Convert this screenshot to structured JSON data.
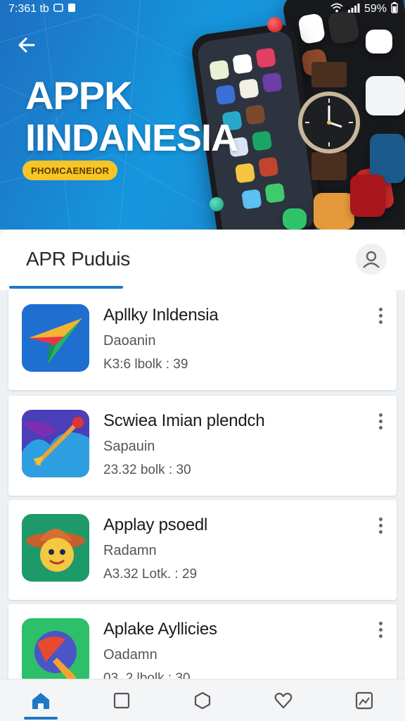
{
  "status_bar": {
    "time": "7:361 tb",
    "battery_text": "59%"
  },
  "hero": {
    "title_line1": "APPK",
    "title_line2": "IINDANESIA",
    "badge": "PHOMCAENEIOR"
  },
  "section": {
    "title": "APR Puduis"
  },
  "apps": [
    {
      "name": "Apllky Inldensia",
      "subtitle": "Daoanin",
      "meta": "K3:6 lbolk : 39"
    },
    {
      "name": "Scwiea Imian plendch",
      "subtitle": "Sapauin",
      "meta": "23.32 bolk : 30"
    },
    {
      "name": "Applay psoedl",
      "subtitle": "Radamn",
      "meta": "A3.32 Lotk. : 29"
    },
    {
      "name": "Aplake Ayllicies",
      "subtitle": "Oadamn",
      "meta": "03. 2 lbolk : 30"
    }
  ],
  "bottom_nav": [
    "home",
    "square",
    "hexagon",
    "heart",
    "image"
  ],
  "colors": {
    "accent": "#1e78c6",
    "badge": "#f7c525",
    "hero_blue": "#1597de"
  }
}
